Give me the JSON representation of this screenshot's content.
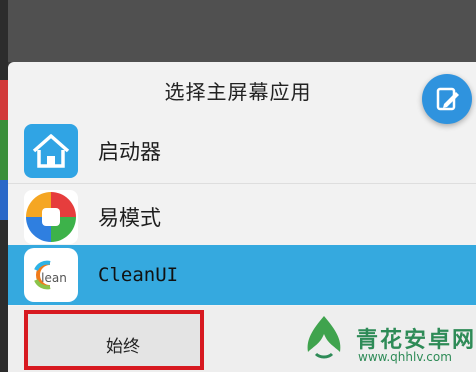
{
  "dialog": {
    "title": "选择主屏幕应用",
    "apps": [
      {
        "label": "启动器",
        "icon": "launcher-home-icon"
      },
      {
        "label": "易模式",
        "icon": "easy-mode-icon"
      },
      {
        "label": "CleanUI",
        "icon": "cleanui-icon",
        "icon_text": "lean",
        "selected": true
      }
    ],
    "always_button": "始终",
    "fab_icon": "edit-icon"
  },
  "watermark": {
    "brand": "青花安卓网",
    "url": "www.qhhlv.com"
  },
  "colors": {
    "selected_row": "#35a9df",
    "highlight_border": "#d71920",
    "fab": "#2f93de"
  }
}
